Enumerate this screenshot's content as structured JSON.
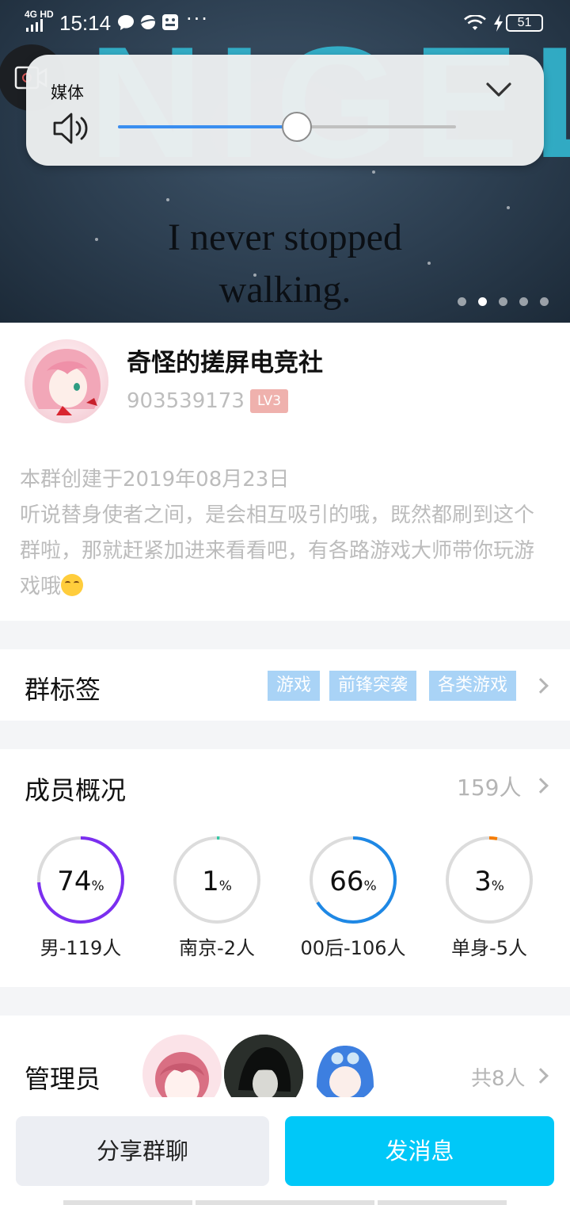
{
  "status_bar": {
    "network": "4G HD",
    "time": "15:14",
    "battery": "51"
  },
  "volume_panel": {
    "label": "媒体",
    "level": 0.53
  },
  "banner": {
    "line1": "I never stopped",
    "line2": "walking.",
    "pages": 5,
    "active_page": 2
  },
  "group": {
    "name": "奇怪的搓屏电竞社",
    "id": "903539173",
    "level": "LV3",
    "created": "本群创建于2019年08月23日",
    "description": "听说替身使者之间，是会相互吸引的哦，既然都刷到这个群啦，那就赶紧加进来看看吧，有各路游戏大师带你玩游戏哦"
  },
  "tags_section": {
    "title": "群标签",
    "tags": [
      "游戏",
      "前锋突袭",
      "各类游戏"
    ]
  },
  "members_section": {
    "title": "成员概况",
    "count": "159人",
    "stats": [
      {
        "value": "74",
        "unit": "%",
        "label": "男-119人",
        "fraction": 0.74,
        "color": "#7b2ff0"
      },
      {
        "value": "1",
        "unit": "%",
        "label": "南京-2人",
        "fraction": 0.01,
        "color": "#35c7a4"
      },
      {
        "value": "66",
        "unit": "%",
        "label": "00后-106人",
        "fraction": 0.66,
        "color": "#1e88e5"
      },
      {
        "value": "3",
        "unit": "%",
        "label": "单身-5人",
        "fraction": 0.03,
        "color": "#f57c00"
      }
    ]
  },
  "admins_section": {
    "title": "管理员",
    "count": "共8人"
  },
  "actions": {
    "share": "分享群聊",
    "send": "发消息"
  },
  "colors": {
    "accent": "#00c8f8",
    "tag_bg": "#a9d3f6",
    "level_badge": "#efb1ad"
  }
}
